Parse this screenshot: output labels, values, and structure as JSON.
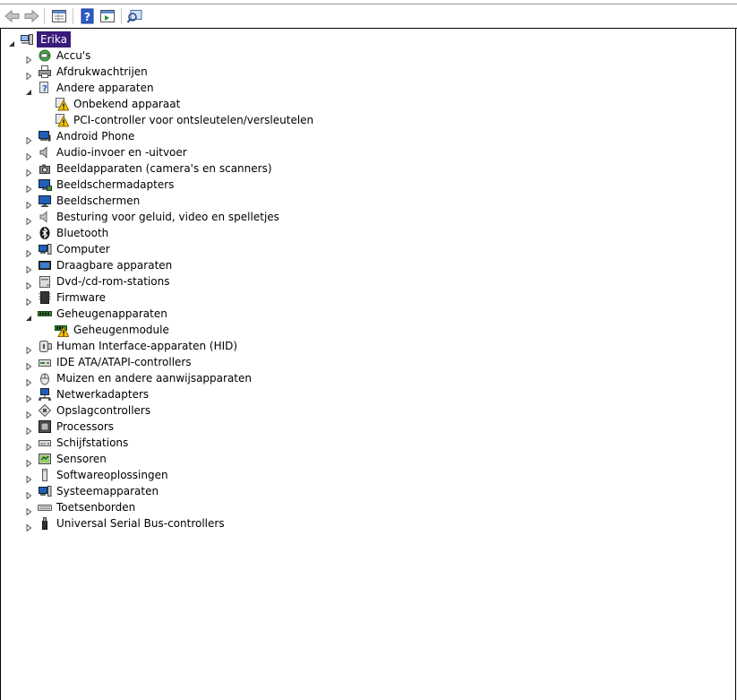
{
  "toolbar": {
    "buttons": [
      {
        "icon": "back-arrow-icon"
      },
      {
        "icon": "forward-arrow-icon"
      },
      {
        "icon": "properties-view-icon"
      },
      {
        "icon": "help-icon"
      },
      {
        "icon": "action-pane-icon"
      },
      {
        "icon": "scan-hardware-icon"
      }
    ]
  },
  "tree": {
    "root": {
      "label": "Erika",
      "icon": "computer-icon",
      "expanded": true
    },
    "items": [
      {
        "label": "Accu's",
        "icon": "battery-icon",
        "expanded": false,
        "children": []
      },
      {
        "label": "Afdrukwachtrijen",
        "icon": "printer-icon",
        "expanded": false,
        "children": []
      },
      {
        "label": "Andere apparaten",
        "icon": "unknown-device-icon",
        "expanded": true,
        "children": [
          {
            "label": "Onbekend apparaat",
            "icon": "warning-device-icon"
          },
          {
            "label": "PCI-controller voor ontsleutelen/versleutelen",
            "icon": "warning-device-icon"
          }
        ]
      },
      {
        "label": "Android Phone",
        "icon": "phone-icon",
        "expanded": false,
        "children": []
      },
      {
        "label": "Audio-invoer en -uitvoer",
        "icon": "speaker-icon",
        "expanded": false,
        "children": []
      },
      {
        "label": "Beeldapparaten (camera's en scanners)",
        "icon": "camera-icon",
        "expanded": false,
        "children": []
      },
      {
        "label": "Beeldschermadapters",
        "icon": "display-adapter-icon",
        "expanded": false,
        "children": []
      },
      {
        "label": "Beeldschermen",
        "icon": "monitor-icon",
        "expanded": false,
        "children": []
      },
      {
        "label": "Besturing voor geluid, video en spelletjes",
        "icon": "sound-icon",
        "expanded": false,
        "children": []
      },
      {
        "label": "Bluetooth",
        "icon": "bluetooth-icon",
        "expanded": false,
        "children": []
      },
      {
        "label": "Computer",
        "icon": "pc-icon",
        "expanded": false,
        "children": []
      },
      {
        "label": "Draagbare apparaten",
        "icon": "portable-device-icon",
        "expanded": false,
        "children": []
      },
      {
        "label": "Dvd-/cd-rom-stations",
        "icon": "optical-drive-icon",
        "expanded": false,
        "children": []
      },
      {
        "label": "Firmware",
        "icon": "firmware-icon",
        "expanded": false,
        "children": []
      },
      {
        "label": "Geheugenapparaten",
        "icon": "memory-icon",
        "expanded": true,
        "children": [
          {
            "label": "Geheugenmodule",
            "icon": "memory-warning-icon"
          }
        ]
      },
      {
        "label": "Human Interface-apparaten (HID)",
        "icon": "hid-icon",
        "expanded": false,
        "children": []
      },
      {
        "label": "IDE ATA/ATAPI-controllers",
        "icon": "ide-icon",
        "expanded": false,
        "children": []
      },
      {
        "label": "Muizen en andere aanwijsapparaten",
        "icon": "mouse-icon",
        "expanded": false,
        "children": []
      },
      {
        "label": "Netwerkadapters",
        "icon": "network-icon",
        "expanded": false,
        "children": []
      },
      {
        "label": "Opslagcontrollers",
        "icon": "storage-controller-icon",
        "expanded": false,
        "children": []
      },
      {
        "label": "Processors",
        "icon": "processor-icon",
        "expanded": false,
        "children": []
      },
      {
        "label": "Schijfstations",
        "icon": "disk-drive-icon",
        "expanded": false,
        "children": []
      },
      {
        "label": "Sensoren",
        "icon": "sensor-icon",
        "expanded": false,
        "children": []
      },
      {
        "label": "Softwareoplossingen",
        "icon": "software-icon",
        "expanded": false,
        "children": []
      },
      {
        "label": "Systeemapparaten",
        "icon": "system-device-icon",
        "expanded": false,
        "children": []
      },
      {
        "label": "Toetsenborden",
        "icon": "keyboard-icon",
        "expanded": false,
        "children": []
      },
      {
        "label": "Universal Serial Bus-controllers",
        "icon": "usb-icon",
        "expanded": false,
        "children": []
      }
    ]
  },
  "colors": {
    "selection_bg": "#3a1a7a",
    "warning": "#f2c300",
    "device_blue": "#1f5fb8"
  }
}
